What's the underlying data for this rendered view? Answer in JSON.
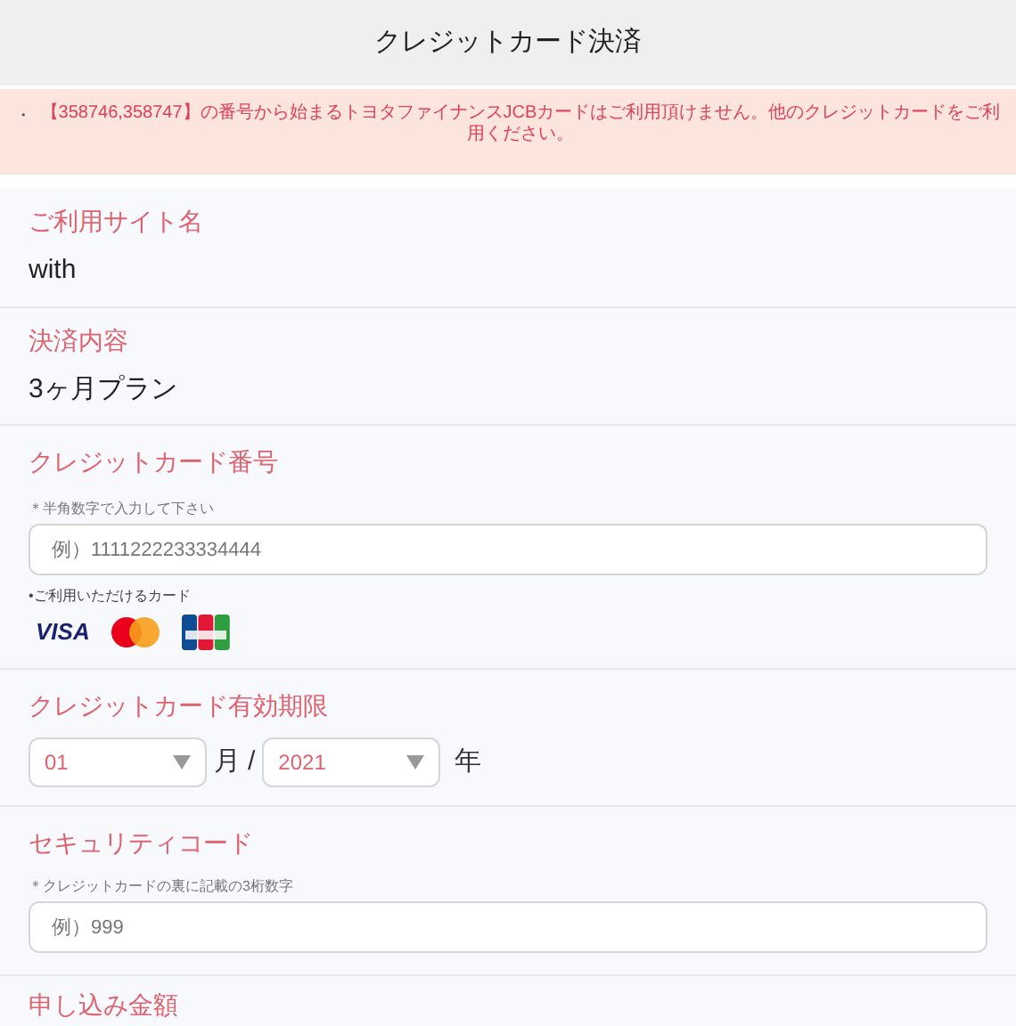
{
  "header": {
    "title": "クレジットカード決済"
  },
  "notice": {
    "bullet": "・",
    "text": "【358746,358747】の番号から始まるトヨタファイナンスJCBカードはご利用頂けません。他のクレジットカードをご利用ください。"
  },
  "sections": [
    {
      "kind": "value",
      "label": "ご利用サイト名",
      "value": "with"
    },
    {
      "kind": "value",
      "label": "決済内容",
      "value": "3ヶ月プラン"
    },
    {
      "kind": "card",
      "label": "クレジットカード番号",
      "hint": "＊半角数字で入力して下さい",
      "placeholder": "例）1111222233334444",
      "cards_label": "•ご利用いただけるカード",
      "cards": [
        {
          "kind": "visa",
          "label": "VISA"
        },
        {
          "kind": "mastercard"
        },
        {
          "kind": "jcb"
        }
      ]
    },
    {
      "kind": "expiry",
      "label": "クレジットカード有効期限",
      "month": "01",
      "month_unit": "月",
      "separator": "/",
      "year": "2021",
      "year_unit": "年"
    },
    {
      "kind": "code",
      "label": "セキュリティコード",
      "hint": "＊クレジットカードの裏に記載の3桁数字",
      "placeholder": "例）999"
    },
    {
      "kind": "heading",
      "label": "申し込み金額"
    }
  ]
}
